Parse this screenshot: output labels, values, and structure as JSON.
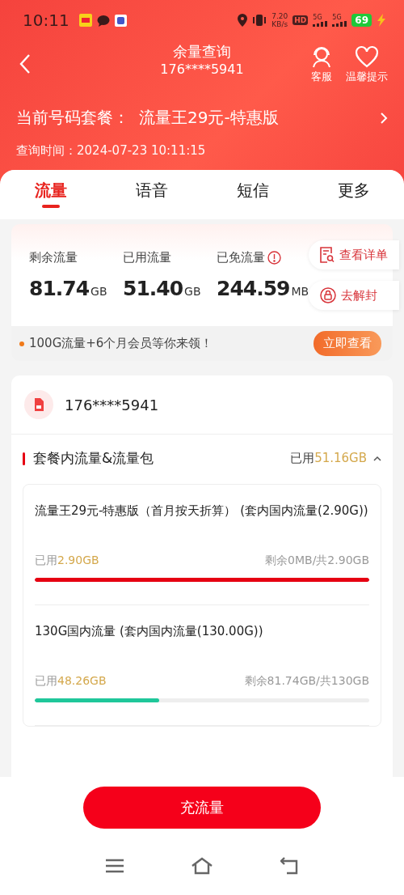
{
  "status_bar": {
    "time": "10:11",
    "net_speed": "7.20",
    "net_unit": "KB/s",
    "hd": "HD",
    "signals": [
      "5G",
      "5G"
    ],
    "battery": "69"
  },
  "header": {
    "title": "余量查询",
    "subtitle": "176****5941",
    "actions": [
      {
        "kind": "service",
        "label": "客服"
      },
      {
        "kind": "tips",
        "label": "温馨提示"
      }
    ]
  },
  "plan": {
    "label": "当前号码套餐：",
    "name": "流量王29元-特惠版",
    "query_time": "查询时间：2024-07-23 10:11:15"
  },
  "tabs": [
    {
      "label": "流量",
      "selected": true
    },
    {
      "label": "语音",
      "selected": false
    },
    {
      "label": "短信",
      "selected": false
    },
    {
      "label": "更多",
      "selected": false
    }
  ],
  "stats": [
    {
      "label": "剩余流量",
      "value": "81.74",
      "unit": "GB",
      "info": false
    },
    {
      "label": "已用流量",
      "value": "51.40",
      "unit": "GB",
      "info": false
    },
    {
      "label": "已免流量",
      "value": "244.59",
      "unit": "MB",
      "info": true
    }
  ],
  "side_actions": [
    {
      "kind": "detail",
      "label": "查看详单"
    },
    {
      "kind": "unlock",
      "label": "去解封"
    }
  ],
  "promo": {
    "text": "100G流量+6个月会员等你来领！",
    "button": "立即查看"
  },
  "phone": "176****5941",
  "package_section": {
    "title": "套餐内流量&流量包",
    "used_label": "已用",
    "used_value": "51.16GB",
    "expanded": true,
    "items": [
      {
        "name": "流量王29元-特惠版（首月按天折算） (套内国内流量(2.90G))",
        "used_label": "已用",
        "used_value": "2.90GB",
        "remaining": "剩余0MB/共2.90GB",
        "level": 1,
        "color": "#e60012"
      },
      {
        "name": "130G国内流量 (套内国内流量(130.00G))",
        "used_label": "已用",
        "used_value": "48.26GB",
        "remaining": "剩余81.74GB/共130GB",
        "level": 0.371,
        "color": "#1fc79a"
      }
    ]
  },
  "recharge_button": "充流量"
}
